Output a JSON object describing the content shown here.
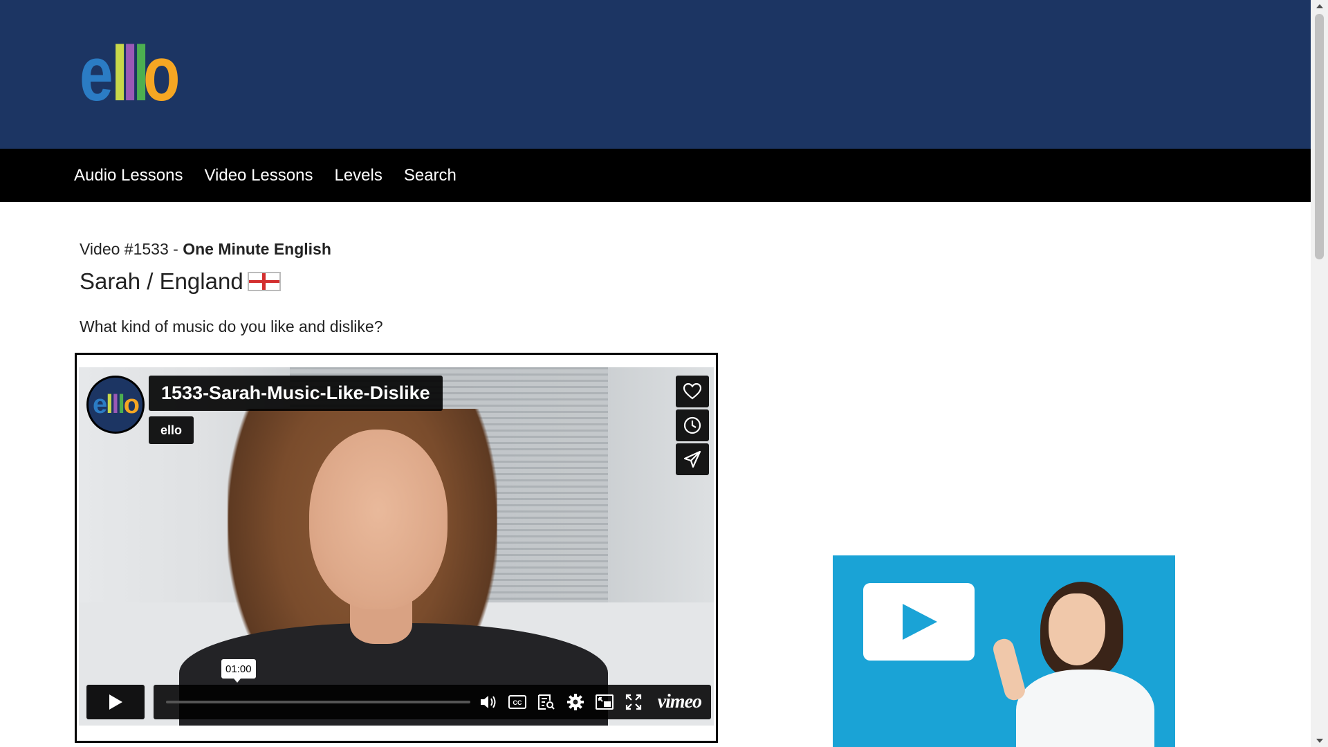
{
  "header": {
    "logo_letters": [
      "e",
      "l",
      "l",
      "l",
      "o"
    ],
    "bg_color": "#1c3563"
  },
  "nav": {
    "items": [
      {
        "label": "Audio Lessons"
      },
      {
        "label": "Video Lessons"
      },
      {
        "label": "Levels"
      },
      {
        "label": "Search"
      }
    ]
  },
  "lesson": {
    "prefix": "Video #1533 - ",
    "series": "One Minute English",
    "speaker": "Sarah / England",
    "flag_icon": "england-flag-icon",
    "question": "What kind of music do you like and dislike?"
  },
  "player": {
    "title": "1533-Sarah-Music-Like-Dislike",
    "owner": "ello",
    "avatar_letters": [
      "e",
      "l",
      "l",
      "l",
      "o"
    ],
    "time_tooltip": "01:00",
    "brand": "vimeo",
    "side_buttons": [
      "heart-icon",
      "clock-icon",
      "share-icon"
    ],
    "control_icons": [
      "volume-icon",
      "cc-icon",
      "transcript-icon",
      "settings-icon",
      "pip-icon",
      "fullscreen-icon"
    ]
  },
  "ad": {
    "icon": "play-icon",
    "bg_color": "#1aa3d6"
  }
}
